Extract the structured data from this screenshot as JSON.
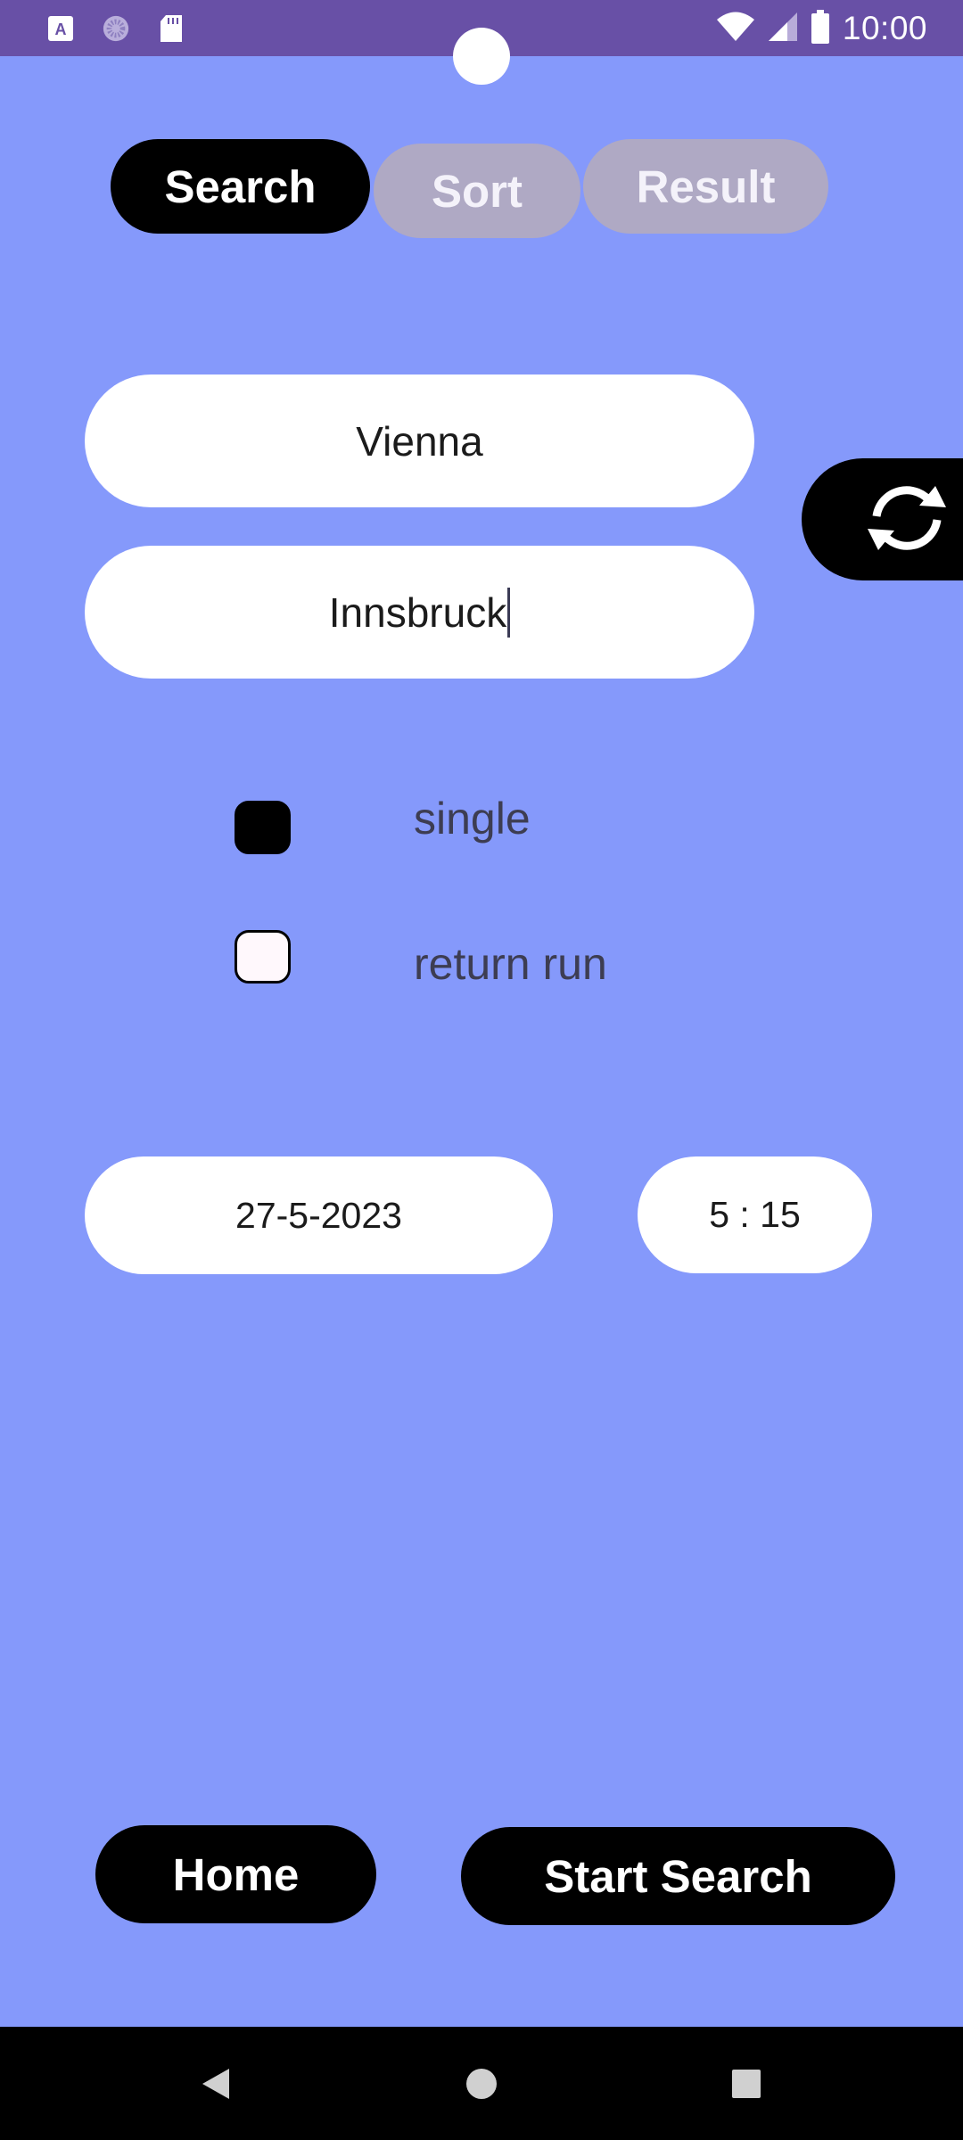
{
  "status_bar": {
    "time": "10:00",
    "icons": [
      "text-a-icon",
      "spinner-icon",
      "sd-card-icon",
      "wifi-icon",
      "signal-icon",
      "battery-icon"
    ]
  },
  "tabs": [
    {
      "label": "Search",
      "active": true
    },
    {
      "label": "Sort",
      "active": false
    },
    {
      "label": "Result",
      "active": false
    }
  ],
  "route": {
    "from_value": "Vienna",
    "to_value": "Innsbruck",
    "swap_icon": "swap-arrows-icon"
  },
  "trip_type": {
    "options": [
      {
        "label": "single",
        "checked": true
      },
      {
        "label": "return run",
        "checked": false
      }
    ]
  },
  "datetime": {
    "date": "27-5-2023",
    "time": "5 : 15"
  },
  "actions": {
    "home_label": "Home",
    "start_label": "Start Search"
  },
  "colors": {
    "background": "#8599FB",
    "status_bar": "#6850A6",
    "inactive_tab": "#AFA9C4",
    "primary_button": "#000000"
  }
}
